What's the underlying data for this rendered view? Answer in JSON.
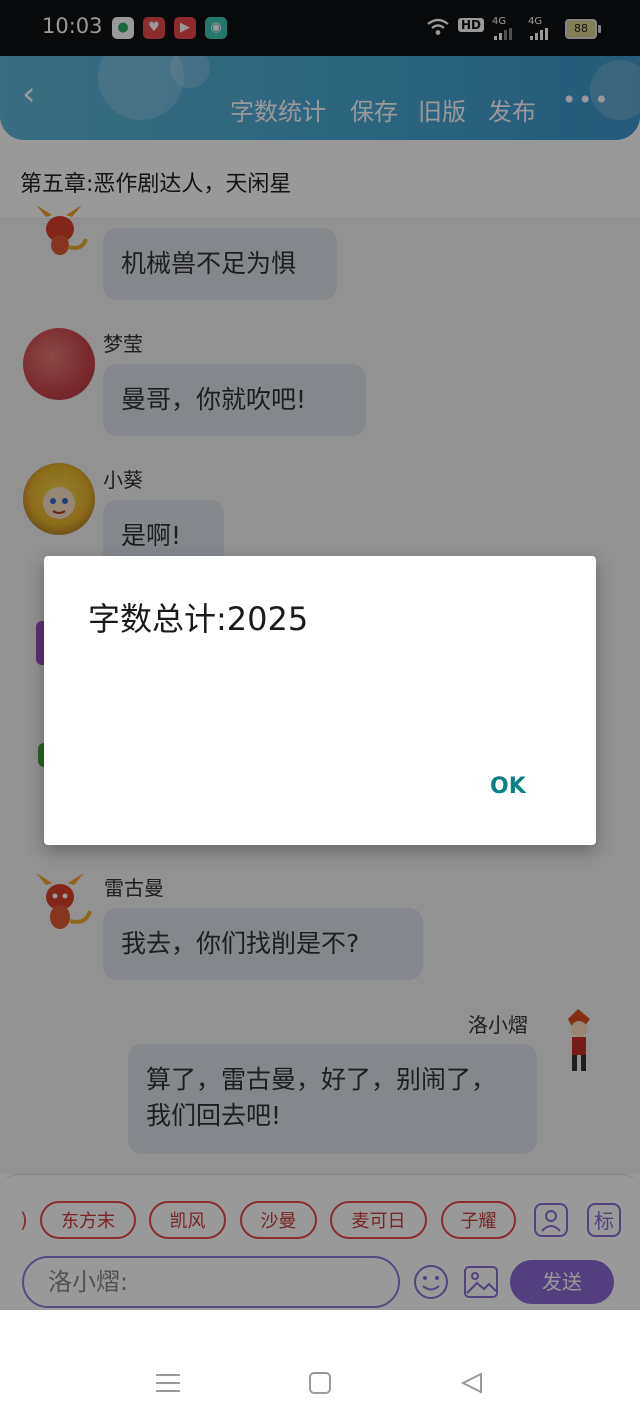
{
  "status_bar": {
    "time": "10:03",
    "network_label": "HD",
    "signal1": "4G",
    "signal2": "4G",
    "battery": "88"
  },
  "toolbar": {
    "actions": [
      "字数统计",
      "保存",
      "旧版",
      "发布"
    ],
    "more": "•••"
  },
  "chapter_title": "第五章:恶作剧达人，天闲星",
  "messages": [
    {
      "name": "",
      "text": "机械兽不足为惧"
    },
    {
      "name": "梦莹",
      "text": "曼哥，你就吹吧!"
    },
    {
      "name": "小葵",
      "text": "是啊!"
    },
    {
      "name": "雷古曼",
      "text": "我去，你们找削是不?"
    },
    {
      "name": "洛小熠",
      "text": "算了，雷古曼，好了，别闹了，我们回去吧!"
    }
  ],
  "quick_chips": [
    "东方末",
    "凯风",
    "沙曼",
    "麦可日",
    "子耀"
  ],
  "extra_buttons": {
    "tag_label": "标"
  },
  "input": {
    "value": "洛小熠:"
  },
  "send_label": "发送",
  "dialog": {
    "title": "字数总计:2025",
    "ok_label": "OK"
  },
  "colors": {
    "header": "#47a8d3",
    "chip_border": "#e24c4c",
    "accent_purple": "#8a6ad6",
    "dialog_ok": "#0a7f86"
  }
}
